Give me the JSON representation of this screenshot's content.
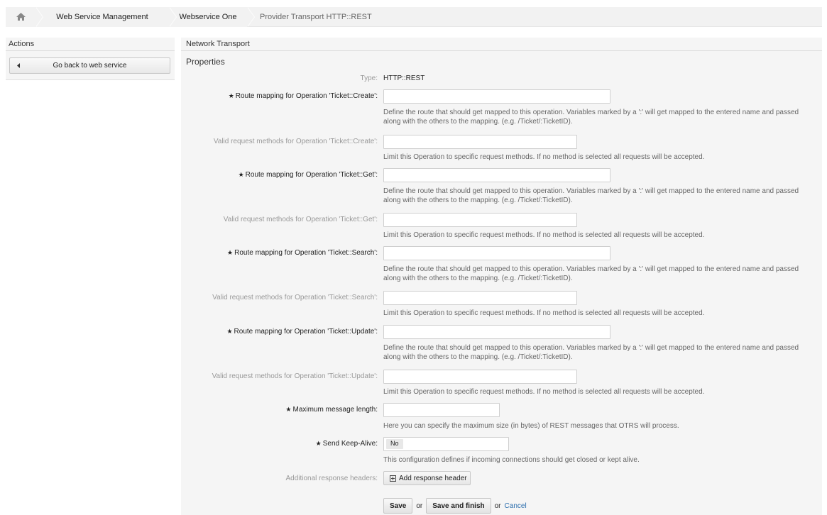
{
  "breadcrumb": {
    "items": [
      "Web Service Management",
      "Webservice One",
      "Provider Transport HTTP::REST"
    ]
  },
  "sidebar": {
    "title": "Actions",
    "back_button": "Go back to web service"
  },
  "main": {
    "title": "Network Transport",
    "subtitle": "Properties",
    "type_label": "Type:",
    "type_value": "HTTP::REST",
    "fields": [
      {
        "label": "Route mapping for Operation 'Ticket::Create':",
        "required": true,
        "desc": "Define the route that should get mapped to this operation. Variables marked by a ':' will get mapped to the entered name and passed along with the others to the mapping. (e.g. /Ticket/:TicketID)."
      },
      {
        "label": "Valid request methods for Operation 'Ticket::Create':",
        "required": false,
        "desc": "Limit this Operation to specific request methods. If no method is selected all requests will be accepted."
      },
      {
        "label": "Route mapping for Operation 'Ticket::Get':",
        "required": true,
        "desc": "Define the route that should get mapped to this operation. Variables marked by a ':' will get mapped to the entered name and passed along with the others to the mapping. (e.g. /Ticket/:TicketID)."
      },
      {
        "label": "Valid request methods for Operation 'Ticket::Get':",
        "required": false,
        "desc": "Limit this Operation to specific request methods. If no method is selected all requests will be accepted."
      },
      {
        "label": "Route mapping for Operation 'Ticket::Search':",
        "required": true,
        "desc": "Define the route that should get mapped to this operation. Variables marked by a ':' will get mapped to the entered name and passed along with the others to the mapping. (e.g. /Ticket/:TicketID)."
      },
      {
        "label": "Valid request methods for Operation 'Ticket::Search':",
        "required": false,
        "desc": "Limit this Operation to specific request methods. If no method is selected all requests will be accepted."
      },
      {
        "label": "Route mapping for Operation 'Ticket::Update':",
        "required": true,
        "desc": "Define the route that should get mapped to this operation. Variables marked by a ':' will get mapped to the entered name and passed along with the others to the mapping. (e.g. /Ticket/:TicketID)."
      },
      {
        "label": "Valid request methods for Operation 'Ticket::Update':",
        "required": false,
        "desc": "Limit this Operation to specific request methods. If no method is selected all requests will be accepted."
      },
      {
        "label": "Maximum message length:",
        "required": true,
        "desc": "Here you can specify the maximum size (in bytes) of REST messages that OTRS will process."
      },
      {
        "label": "Send Keep-Alive:",
        "required": true,
        "value": "No",
        "desc": "This configuration defines if incoming connections should get closed or kept alive."
      },
      {
        "label": "Additional response headers:",
        "required": false
      }
    ],
    "add_header_button": "Add response header",
    "save_button": "Save",
    "or_text": "or",
    "save_finish_button": "Save and finish",
    "or_text2": "or",
    "cancel_link": "Cancel"
  },
  "colors": {
    "panel_bg": "#f5f5f5",
    "link": "#2a6dad"
  }
}
